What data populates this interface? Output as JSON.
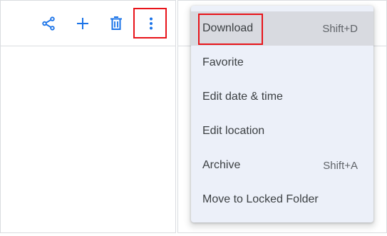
{
  "toolbar": {
    "icons": [
      "share-icon",
      "add-icon",
      "delete-icon",
      "more-vert-icon"
    ],
    "icon_color": "#1a73e8"
  },
  "menu": {
    "items": [
      {
        "label": "Download",
        "shortcut": "Shift+D",
        "hovered": true
      },
      {
        "label": "Favorite",
        "shortcut": ""
      },
      {
        "label": "Edit date & time",
        "shortcut": ""
      },
      {
        "label": "Edit location",
        "shortcut": ""
      },
      {
        "label": "Archive",
        "shortcut": "Shift+A"
      },
      {
        "label": "Move to Locked Folder",
        "shortcut": ""
      }
    ]
  },
  "colors": {
    "accent": "#1a73e8",
    "highlight": "#e8141a",
    "menu_background": "#ecf0f9",
    "menu_hover": "#d8dae0"
  }
}
